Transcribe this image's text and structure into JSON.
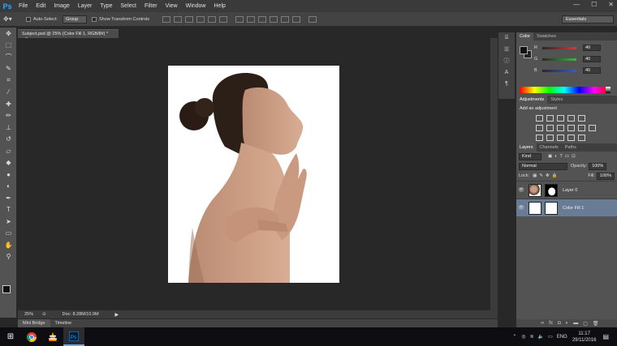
{
  "menubar": {
    "logo": "Ps",
    "items": [
      "File",
      "Edit",
      "Image",
      "Layer",
      "Type",
      "Select",
      "Filter",
      "View",
      "Window",
      "Help"
    ],
    "minimize": "—",
    "maximize": "☐",
    "close": "✕"
  },
  "options": {
    "auto_select_label": "Auto-Select:",
    "auto_select_value": "Group",
    "transform_label": "Show Transform Controls",
    "workspace": "Essentials"
  },
  "document": {
    "tab_title": "Subject.psd @ 25% (Color Fill 1, RGB/8#) *",
    "tab_close": "×",
    "zoom": "25%",
    "doc_info": "Doc: 8.28M/10.9M"
  },
  "bottom_tabs": [
    "Mini Bridge",
    "Timeline"
  ],
  "color_panel": {
    "tabs": [
      "Color",
      "Swatches"
    ],
    "rows": [
      {
        "label": "R",
        "value": "40",
        "color": "#d23a3a"
      },
      {
        "label": "G",
        "value": "40",
        "color": "#3ab83a"
      },
      {
        "label": "B",
        "value": "40",
        "color": "#3a5ad2"
      }
    ]
  },
  "adjustments_panel": {
    "tabs": [
      "Adjustments",
      "Styles"
    ],
    "title": "Add an adjustment"
  },
  "layers_panel": {
    "tabs": [
      "Layers",
      "Channels",
      "Paths"
    ],
    "kind": "Kind",
    "blend_mode": "Normal",
    "opacity_label": "Opacity:",
    "opacity_value": "100%",
    "lock_label": "Lock:",
    "fill_label": "Fill:",
    "fill_value": "100%",
    "layers": [
      {
        "name": "Layer 0",
        "selected": false
      },
      {
        "name": "Color Fill 1",
        "selected": true
      }
    ]
  },
  "taskbar": {
    "language": "ENG",
    "time": "11:17",
    "date": "29/11/2016"
  }
}
